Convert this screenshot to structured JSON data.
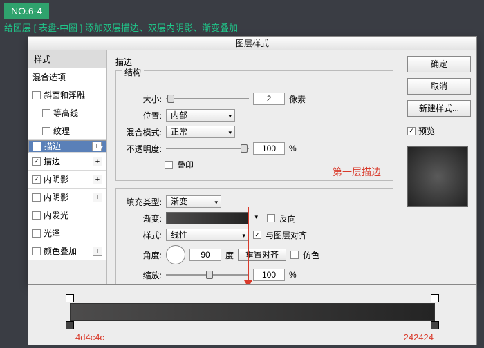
{
  "tag": "NO.6-4",
  "subtitle": "给图层 [ 表盘-中圈 ] 添加双层描边、双层内阴影、渐变叠加",
  "dialog": {
    "title": "图层样式",
    "styles_header": "样式",
    "blend_options": "混合选项",
    "items": [
      {
        "label": "斜面和浮雕",
        "checked": false,
        "plus": false,
        "indent": 0
      },
      {
        "label": "等高线",
        "checked": false,
        "plus": false,
        "indent": 1
      },
      {
        "label": "纹理",
        "checked": false,
        "plus": false,
        "indent": 1
      },
      {
        "label": "描边",
        "checked": true,
        "plus": true,
        "indent": 0,
        "selected": true
      },
      {
        "label": "描边",
        "checked": true,
        "plus": true,
        "indent": 0
      },
      {
        "label": "内阴影",
        "checked": true,
        "plus": true,
        "indent": 0
      },
      {
        "label": "内阴影",
        "checked": false,
        "plus": true,
        "indent": 0
      },
      {
        "label": "内发光",
        "checked": false,
        "plus": false,
        "indent": 0
      },
      {
        "label": "光泽",
        "checked": false,
        "plus": false,
        "indent": 0
      },
      {
        "label": "颜色叠加",
        "checked": false,
        "plus": true,
        "indent": 0
      }
    ],
    "stroke_title": "描边",
    "struct_title": "结构",
    "size_label": "大小:",
    "size_value": "2",
    "size_unit": "像素",
    "pos_label": "位置:",
    "pos_value": "内部",
    "blend_label": "混合模式:",
    "blend_value": "正常",
    "opacity_label": "不透明度:",
    "opacity_value": "100",
    "opacity_unit": "%",
    "overprint": "叠印",
    "fill_label": "填充类型:",
    "fill_value": "渐变",
    "grad_label": "渐变:",
    "reverse": "反向",
    "style_label": "样式:",
    "style_value": "线性",
    "align": "与图层对齐",
    "angle_label": "角度:",
    "angle_value": "90",
    "angle_unit": "度",
    "reset": "重置对齐",
    "dither": "仿色",
    "scale_label": "缩放:",
    "scale_value": "100",
    "scale_unit": "%"
  },
  "annot1": "第一层描边",
  "right": {
    "ok": "确定",
    "cancel": "取消",
    "newstyle": "新建样式...",
    "preview": "预览"
  },
  "colors": {
    "left": "4d4c4c",
    "right": "242424"
  }
}
